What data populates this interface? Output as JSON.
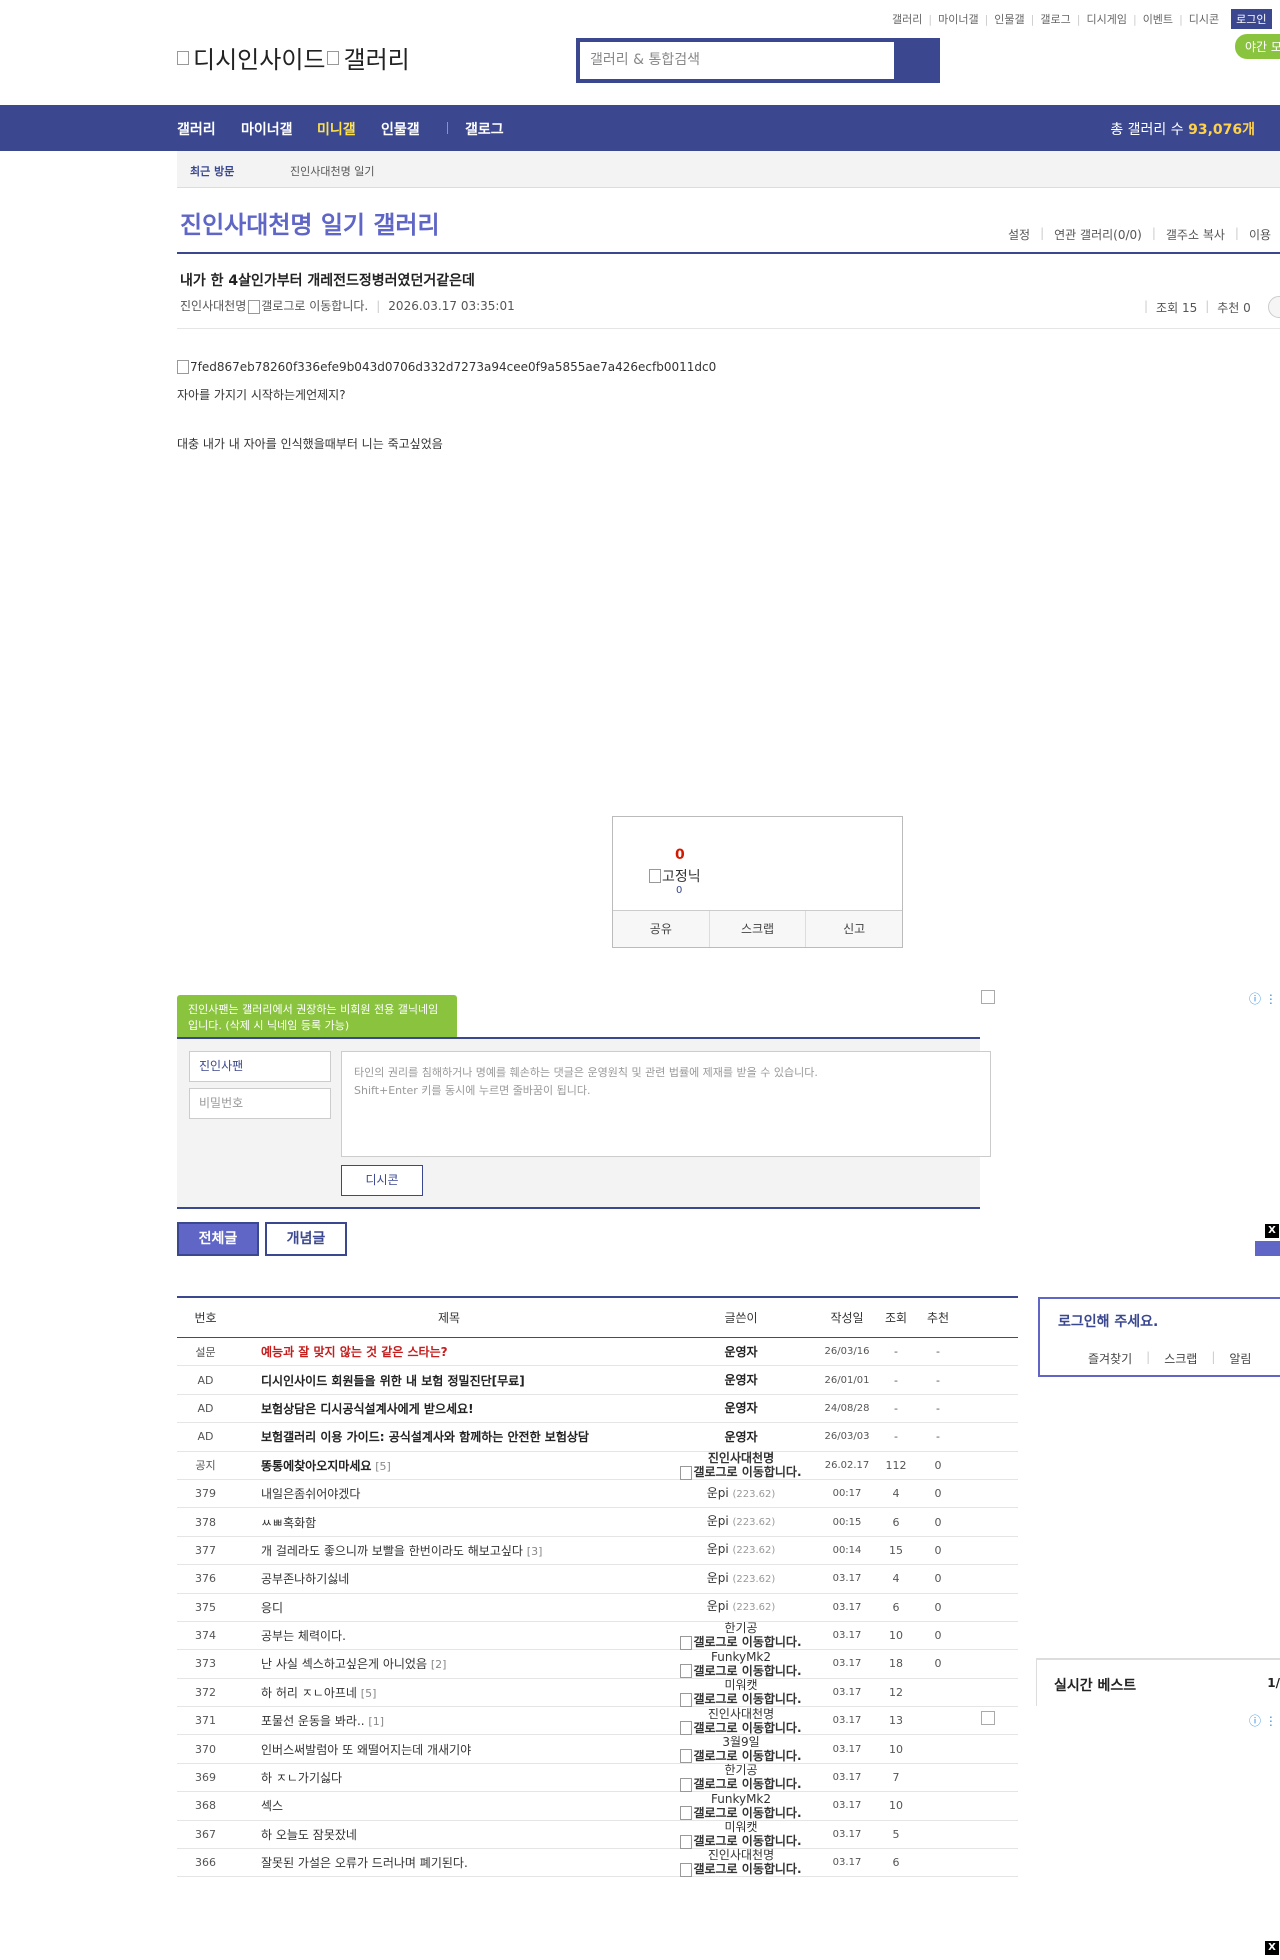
{
  "toplinks": [
    "갤러리",
    "마이너갤",
    "인물갤",
    "갤로그",
    "디시게임",
    "이벤트",
    "디시콘"
  ],
  "login_label": "로그인",
  "night_label": "야간 모드",
  "logo": {
    "part1": "디시인사이드",
    "part2": "갤러리"
  },
  "search": {
    "placeholder": "갤러리 & 통합검색"
  },
  "nav": {
    "items": [
      "갤러리",
      "마이너갤",
      "미니갤",
      "인물갤",
      "갤로그"
    ],
    "count_label": "총 갤러리 수",
    "count_value": "93,076개"
  },
  "recent": {
    "label": "최근 방문",
    "value": "진인사대천명 일기"
  },
  "gallery_title": "진인사대천명 일기 갤러리",
  "gallery_menu": [
    "설정",
    "연관 갤러리(0/0)",
    "갤주소 복사",
    "이용"
  ],
  "post": {
    "title": "내가 한 4살인가부터 개레전드정병러였던거같은데",
    "writer": "진인사대천명",
    "gallog_alt": "갤로그로 이동합니다.",
    "date": "2026.03.17 03:35:01",
    "views": "조회 15",
    "recommend": "추천 0",
    "image_alt": "7fed867eb78260f336efe9b043d0706d332d7273a94cee0f9a5855ae7a426ecfb0011dc0",
    "line1": "자아를 가지기 시작하는게언제지?",
    "line2": "대충 내가 내 자아를 인식했을때부터 니는 죽고싶었음"
  },
  "recbox": {
    "count": "0",
    "fixnick_alt": "고정닉",
    "fix_count": "0",
    "buttons": [
      "공유",
      "스크랩",
      "신고"
    ]
  },
  "comment": {
    "tooltip": "진인사팬는 갤러리에서 권장하는 비회원 전용 갤닉네임입니다. (삭제 시 닉네임 등록 가능)",
    "nick": "진인사팬",
    "password_placeholder": "비밀번호",
    "text_line1": "타인의 권리를 침해하거나 명예를 훼손하는 댓글은 운영원칙 및 관련 법률에 제재를 받을 수 있습니다.",
    "text_line2": "Shift+Enter 키를 동시에 누르면 줄바꿈이 됩니다.",
    "dccon_label": "디시콘"
  },
  "ad_x": "X",
  "tabs": [
    "전체글",
    "개념글"
  ],
  "list": {
    "headers": [
      "번호",
      "제목",
      "글쓴이",
      "작성일",
      "조회",
      "추천"
    ],
    "rows": [
      {
        "no": "설문",
        "title": "예능과 잘 맞지 않는 것 같은 스타는?",
        "cmt": "",
        "style": "red",
        "writer": "운영자",
        "ip": "",
        "gallog": false,
        "date": "26/03/16",
        "views": "-",
        "rec": "-"
      },
      {
        "no": "AD",
        "title": "디시인사이드 회원들을 위한 내 보험 정밀진단[무료]",
        "cmt": "",
        "style": "bold",
        "writer": "운영자",
        "ip": "",
        "gallog": false,
        "date": "26/01/01",
        "views": "-",
        "rec": "-"
      },
      {
        "no": "AD",
        "title": "보험상담은 디시공식설계사에게 받으세요!",
        "cmt": "",
        "style": "bold",
        "writer": "운영자",
        "ip": "",
        "gallog": false,
        "date": "24/08/28",
        "views": "-",
        "rec": "-"
      },
      {
        "no": "AD",
        "title": "보험갤러리 이용 가이드: 공식설계사와 함께하는 안전한 보험상담",
        "cmt": "",
        "style": "bold",
        "writer": "운영자",
        "ip": "",
        "gallog": false,
        "date": "26/03/03",
        "views": "-",
        "rec": "-"
      },
      {
        "no": "공지",
        "title": "똥통에찾아오지마세요",
        "cmt": "[5]",
        "style": "bold",
        "writer": "진인사대천명",
        "ip": "",
        "gallog": true,
        "gallog_bold": true,
        "date": "26.02.17",
        "views": "112",
        "rec": "0"
      },
      {
        "no": "379",
        "title": "내일은좀쉬어야겠다",
        "cmt": "",
        "style": "",
        "writer": "운pi",
        "ip": "(223.62)",
        "gallog": false,
        "date": "00:17",
        "views": "4",
        "rec": "0"
      },
      {
        "no": "378",
        "title": "ㅆㅃ혹화함",
        "cmt": "",
        "style": "",
        "writer": "운pi",
        "ip": "(223.62)",
        "gallog": false,
        "date": "00:15",
        "views": "6",
        "rec": "0"
      },
      {
        "no": "377",
        "title": "개 걸레라도 좋으니까 보빨을 한번이라도 해보고싶다",
        "cmt": "[3]",
        "style": "",
        "writer": "운pi",
        "ip": "(223.62)",
        "gallog": false,
        "date": "00:14",
        "views": "15",
        "rec": "0"
      },
      {
        "no": "376",
        "title": "공부존나하기싫네",
        "cmt": "",
        "style": "",
        "writer": "운pi",
        "ip": "(223.62)",
        "gallog": false,
        "date": "03.17",
        "views": "4",
        "rec": "0"
      },
      {
        "no": "375",
        "title": "응디",
        "cmt": "",
        "style": "",
        "writer": "운pi",
        "ip": "(223.62)",
        "gallog": false,
        "date": "03.17",
        "views": "6",
        "rec": "0"
      },
      {
        "no": "374",
        "title": "공부는 체력이다.",
        "cmt": "",
        "style": "",
        "writer": "한기공",
        "ip": "",
        "gallog": true,
        "date": "03.17",
        "views": "10",
        "rec": "0"
      },
      {
        "no": "373",
        "title": "난 사실 섹스하고싶은게 아니었음",
        "cmt": "[2]",
        "style": "",
        "writer": "FunkyMk2",
        "ip": "",
        "gallog": true,
        "date": "03.17",
        "views": "18",
        "rec": "0"
      },
      {
        "no": "372",
        "title": "하 허리 ㅈㄴ아프네",
        "cmt": "[5]",
        "style": "",
        "writer": "미워캣",
        "ip": "",
        "gallog": true,
        "date": "03.17",
        "views": "12",
        "rec": ""
      },
      {
        "no": "371",
        "title": "포물선 운동을 봐라..",
        "cmt": "[1]",
        "style": "",
        "writer": "진인사대천명",
        "ip": "",
        "gallog": true,
        "date": "03.17",
        "views": "13",
        "rec": ""
      },
      {
        "no": "370",
        "title": "인버스써발럼아 또 왜떨어지는데 개새기야",
        "cmt": "",
        "style": "",
        "writer": "3월9일",
        "ip": "",
        "gallog": true,
        "date": "03.17",
        "views": "10",
        "rec": ""
      },
      {
        "no": "369",
        "title": "하 ㅈㄴ가기싫다",
        "cmt": "",
        "style": "",
        "writer": "한기공",
        "ip": "",
        "gallog": true,
        "date": "03.17",
        "views": "7",
        "rec": ""
      },
      {
        "no": "368",
        "title": "섹스",
        "cmt": "",
        "style": "",
        "writer": "FunkyMk2",
        "ip": "",
        "gallog": true,
        "date": "03.17",
        "views": "10",
        "rec": ""
      },
      {
        "no": "367",
        "title": "하 오늘도 잠못잤네",
        "cmt": "",
        "style": "",
        "writer": "미워캣",
        "ip": "",
        "gallog": true,
        "date": "03.17",
        "views": "5",
        "rec": ""
      },
      {
        "no": "366",
        "title": "잘못된 가설은 오류가 드러나며 폐기된다.",
        "cmt": "",
        "style": "",
        "writer": "진인사대천명",
        "ip": "",
        "gallog": true,
        "date": "03.17",
        "views": "6",
        "rec": ""
      }
    ],
    "gallog_alt": "갤로그로 이동합니다."
  },
  "loginbox": {
    "title": "로그인해 주세요.",
    "links": [
      "즐겨찾기",
      "스크랩",
      "알림"
    ]
  },
  "best": {
    "title": "실시간 베스트",
    "page": "1/"
  }
}
